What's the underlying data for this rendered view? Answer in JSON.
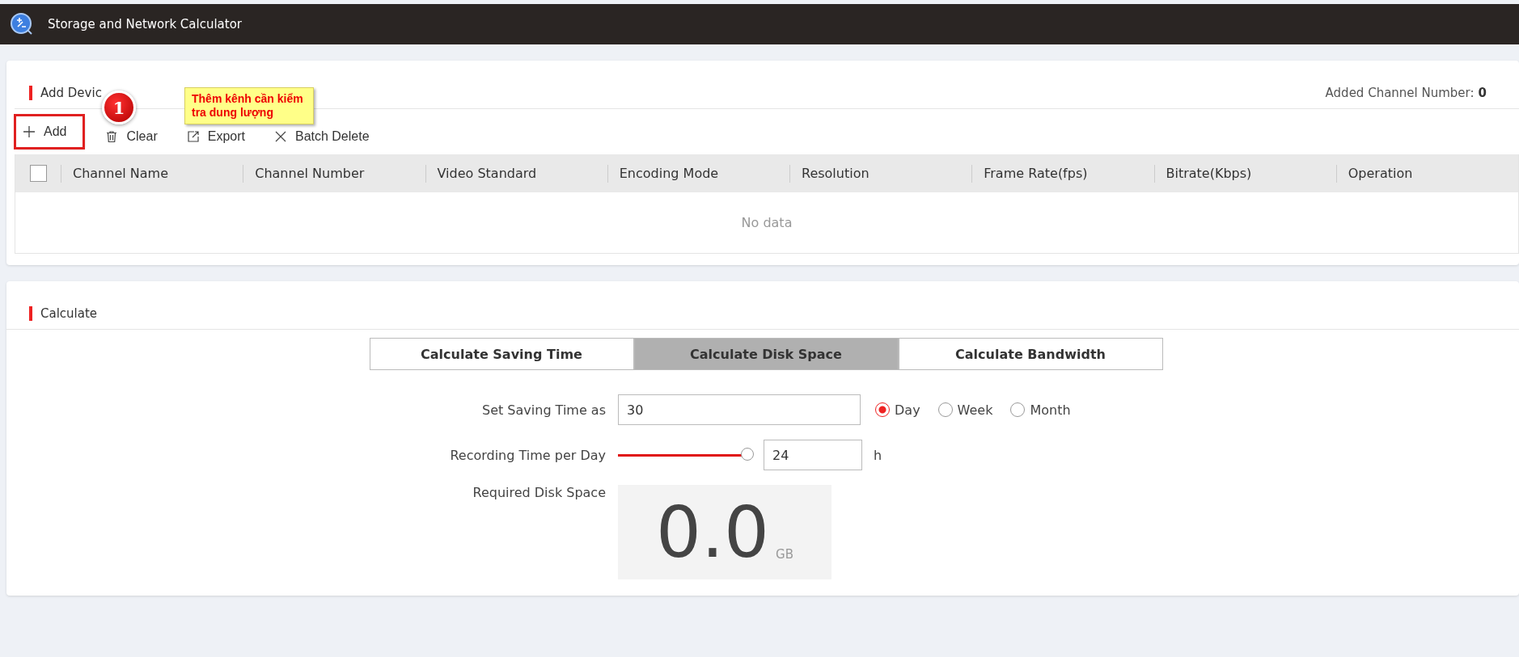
{
  "window": {
    "title": "Storage and Network Calculator"
  },
  "add_device": {
    "title": "Add Devic",
    "added_channel_label": "Added Channel Number:",
    "added_channel_count": "0",
    "toolbar": [
      {
        "kind": "add",
        "label": "Add",
        "highlighted": true
      },
      {
        "kind": "clear",
        "label": "Clear",
        "highlighted": false
      },
      {
        "kind": "export",
        "label": "Export",
        "highlighted": false
      },
      {
        "kind": "delete",
        "label": "Batch Delete",
        "highlighted": false
      }
    ],
    "annotation": {
      "badge": "1",
      "note": "Thêm kênh cần kiểm tra dung lượng"
    },
    "table": {
      "select_all_checked": false,
      "columns": [
        "Channel Name",
        "Channel Number",
        "Video Standard",
        "Encoding Mode",
        "Resolution",
        "Frame Rate(fps)",
        "Bitrate(Kbps)",
        "Operation"
      ],
      "empty_text": "No data"
    }
  },
  "calculate": {
    "title": "Calculate",
    "tabs": [
      {
        "label": "Calculate Saving Time",
        "selected": false
      },
      {
        "label": "Calculate Disk Space",
        "selected": true
      },
      {
        "label": "Calculate Bandwidth",
        "selected": false
      }
    ],
    "saving_time": {
      "label": "Set Saving Time as",
      "value": "30",
      "units": [
        {
          "label": "Day",
          "selected": true
        },
        {
          "label": "Week",
          "selected": false
        },
        {
          "label": "Month",
          "selected": false
        }
      ]
    },
    "recording_time": {
      "label": "Recording Time per Day",
      "level": 1,
      "value": "24",
      "unit": "h"
    },
    "required_disk_space": {
      "label": "Required Disk Space",
      "value": "0.0",
      "unit": "GB"
    }
  }
}
